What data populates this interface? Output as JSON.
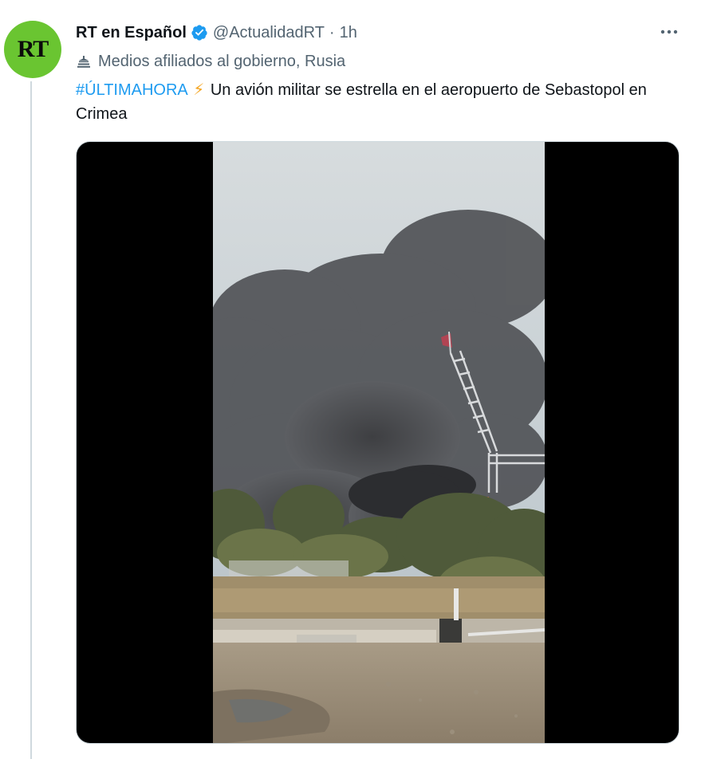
{
  "author": {
    "display_name": "RT en Español",
    "handle": "@ActualidadRT",
    "separator": "·",
    "time": "1h",
    "avatar_text": "RT",
    "avatar_color": "#6ac531",
    "verified": true
  },
  "affiliation": {
    "icon": "state-affiliated-icon",
    "label": "Medios afiliados al gobierno, Rusia"
  },
  "tweet": {
    "hashtag": "#ÚLTIMAHORA",
    "emoji": "⚡",
    "text": "Un avión militar se estrella en el aeropuerto de Sebastopol en Crimea"
  },
  "more_label": "•••",
  "colors": {
    "link": "#1d9bf0",
    "verified": "#1d9bf0",
    "muted": "#536471",
    "thread_line": "#cfd9de"
  }
}
